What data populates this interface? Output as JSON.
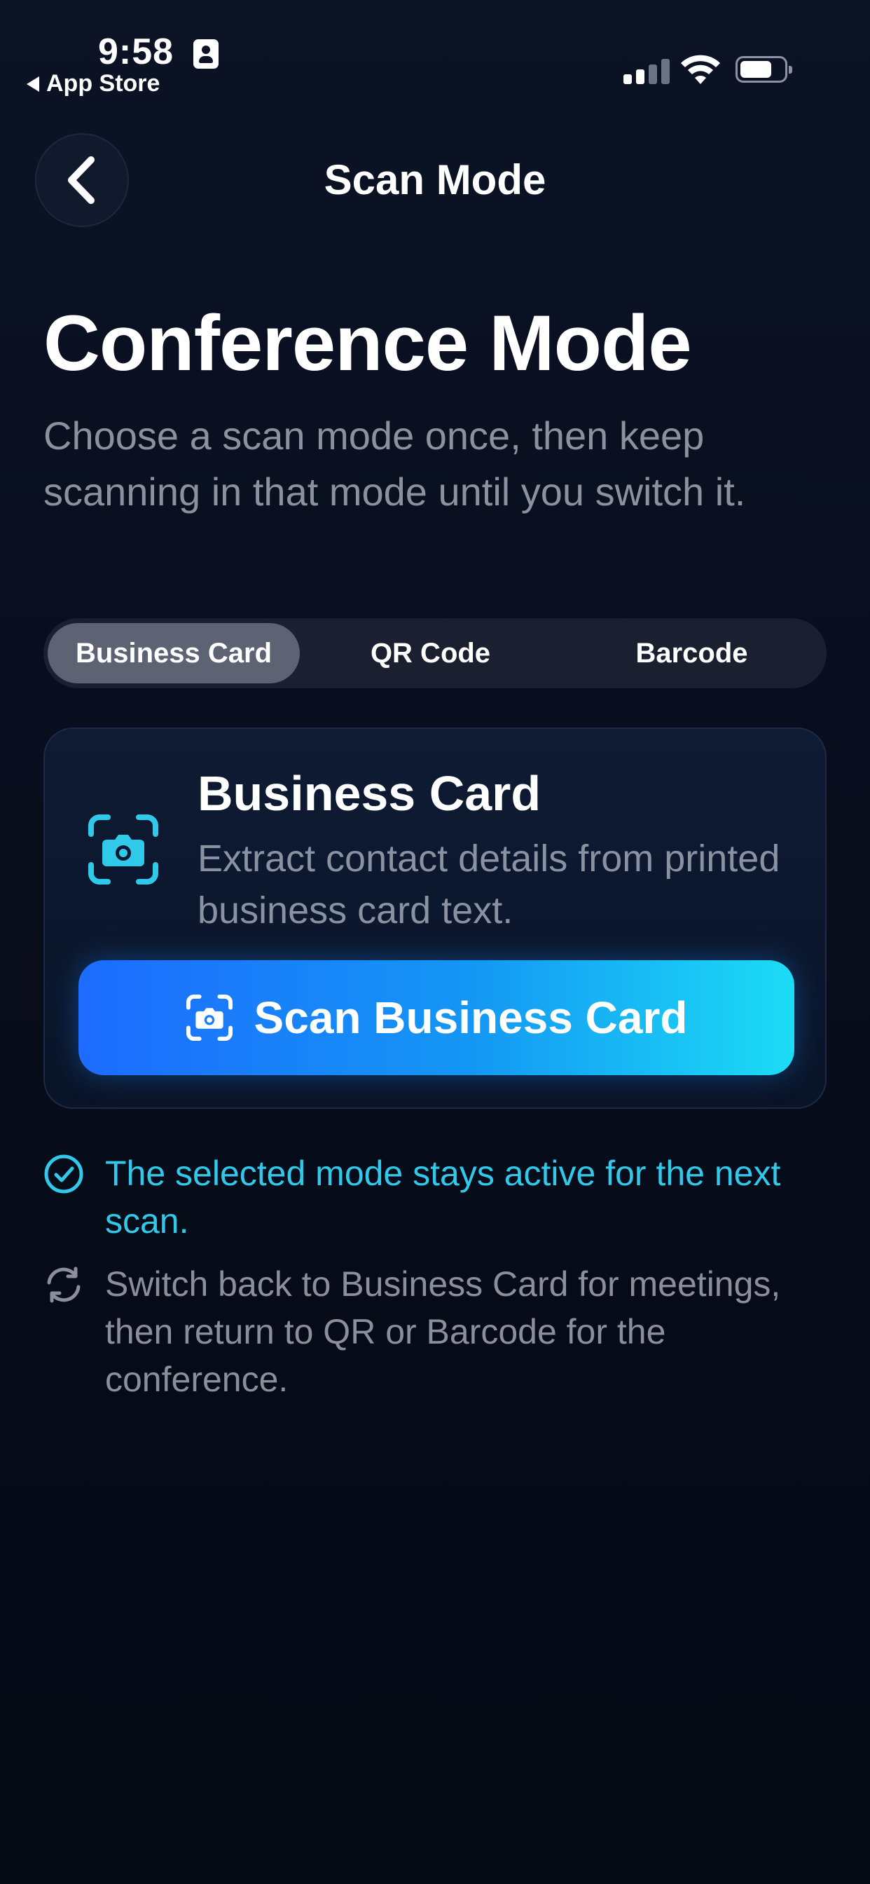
{
  "status_bar": {
    "time": "9:58",
    "back_app_label": "App Store"
  },
  "nav": {
    "title": "Scan Mode"
  },
  "hero": {
    "title": "Conference Mode",
    "subtitle": "Choose a scan mode once, then keep scanning in that mode until you switch it."
  },
  "segments": [
    {
      "label": "Business Card",
      "selected": true
    },
    {
      "label": "QR Code",
      "selected": false
    },
    {
      "label": "Barcode",
      "selected": false
    }
  ],
  "card": {
    "icon": "camera-scan-icon",
    "title": "Business Card",
    "description": "Extract contact details from printed business card text.",
    "button_label": "Scan Business Card",
    "button_icon": "camera-scan-icon"
  },
  "info": [
    {
      "icon": "check-circle-icon",
      "text": "The selected mode stays active for the next scan.",
      "color": "#31c9ea"
    },
    {
      "icon": "refresh-icon",
      "text": "Switch back to Business Card for meetings, then return to QR or Barcode for the conference.",
      "color": "#8a8f9b"
    }
  ],
  "colors": {
    "accent": "#31c9ea",
    "button_gradient_start": "#1d6bff",
    "button_gradient_end": "#1cdcf5",
    "background": "#070b18"
  }
}
